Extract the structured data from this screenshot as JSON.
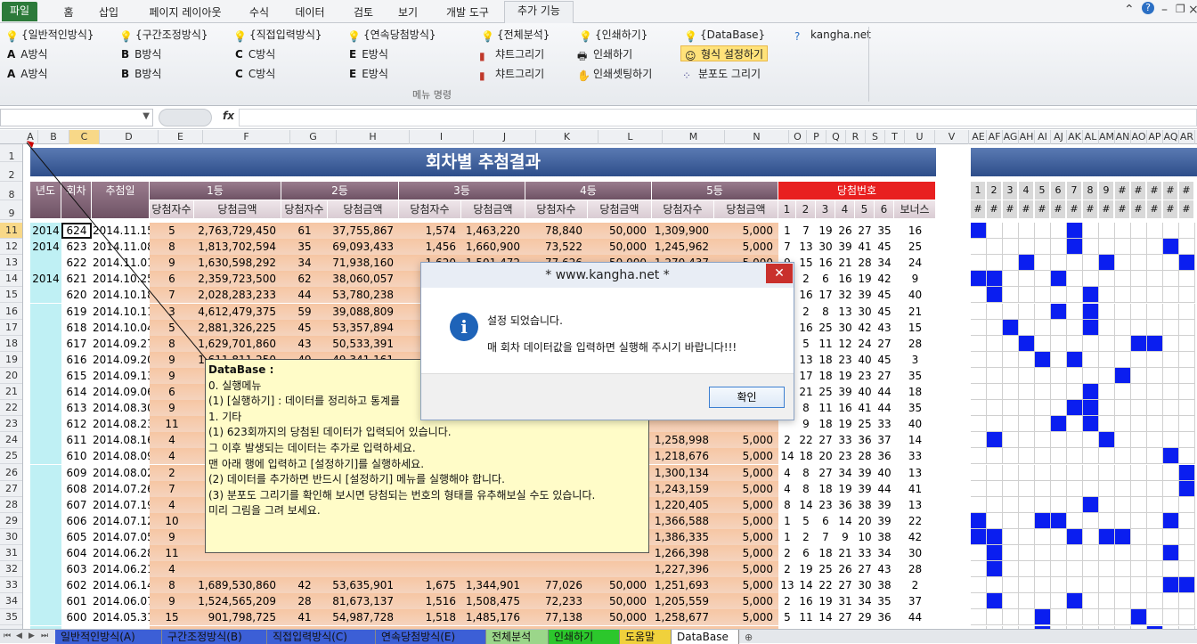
{
  "ribbon_tabs": [
    "파일",
    "홈",
    "삽입",
    "페이지 레이아웃",
    "수식",
    "데이터",
    "검토",
    "보기",
    "개발 도구",
    "추가 기능"
  ],
  "ribbon": {
    "group_label": "메뉴 명령",
    "col1": [
      "{일반적인방식}",
      "A방식",
      "A방식"
    ],
    "col2": [
      "{구간조정방식}",
      "B방식",
      "B방식"
    ],
    "col3": [
      "{직접입력방식}",
      "C방식",
      "C방식"
    ],
    "col4": [
      "{연속당첨방식}",
      "E방식",
      "E방식"
    ],
    "col5": [
      "{전체분석}",
      "챠트그리기",
      "챠트그리기"
    ],
    "col6": [
      "{인쇄하기}",
      "인쇄하기",
      "인쇄셋팅하기"
    ],
    "col7": [
      "{DataBase}",
      "형식 설정하기",
      "분포도 그리기"
    ],
    "col8": [
      "kangha.net"
    ],
    "letters": [
      "A",
      "A",
      "B",
      "B",
      "C",
      "C",
      "E",
      "E"
    ]
  },
  "formula_bar": {
    "fx": "fx"
  },
  "column_headers": [
    "A",
    "B",
    "C",
    "D",
    "E",
    "F",
    "G",
    "H",
    "I",
    "J",
    "K",
    "L",
    "M",
    "N",
    "O",
    "P",
    "Q",
    "R",
    "S",
    "T",
    "U",
    "V",
    "AE",
    "AF",
    "AG",
    "AH",
    "AI",
    "AJ",
    "AK",
    "AL",
    "AM",
    "AN",
    "AO",
    "AP",
    "AQ",
    "AR"
  ],
  "row_headers": [
    "1",
    "2",
    "8",
    "9",
    "11",
    "12",
    "13",
    "14",
    "15",
    "16",
    "17",
    "18",
    "19",
    "20",
    "21",
    "22",
    "23",
    "24",
    "25",
    "26",
    "27",
    "28",
    "29",
    "30",
    "31",
    "32",
    "33",
    "34",
    "35",
    "36",
    "37"
  ],
  "sheet": {
    "title": "회차별 추첨결과",
    "headers": [
      "년도",
      "회차",
      "추첨일",
      "1등",
      "2등",
      "3등",
      "4등",
      "5등",
      "당첨번호"
    ],
    "subheaders": [
      "당첨자수",
      "당첨금액",
      "당첨자수",
      "당첨금액",
      "당첨자수",
      "당첨금액",
      "당첨자수",
      "당첨금액",
      "당첨자수",
      "당첨금액",
      "1",
      "2",
      "3",
      "4",
      "5",
      "6",
      "보너스"
    ],
    "grid_numbers": [
      "1",
      "2",
      "3",
      "4",
      "5",
      "6",
      "7",
      "8",
      "9",
      "#",
      "#",
      "#",
      "#",
      "#"
    ],
    "grid_hash": [
      "#",
      "#",
      "#",
      "#",
      "#",
      "#",
      "#",
      "#",
      "#",
      "#",
      "#",
      "#",
      "#",
      "#"
    ],
    "rows": [
      [
        "2014",
        "624",
        "2014.11.15",
        "5",
        "2,763,729,450",
        "61",
        "37,755,867",
        "1,574",
        "1,463,220",
        "78,840",
        "50,000",
        "1,309,900",
        "5,000",
        "1",
        "7",
        "19",
        "26",
        "27",
        "35",
        "16"
      ],
      [
        "2014",
        "623",
        "2014.11.08",
        "8",
        "1,813,702,594",
        "35",
        "69,093,433",
        "1,456",
        "1,660,900",
        "73,522",
        "50,000",
        "1,245,962",
        "5,000",
        "7",
        "13",
        "30",
        "39",
        "41",
        "45",
        "25"
      ],
      [
        "",
        "622",
        "2014.11.01",
        "9",
        "1,630,598,292",
        "34",
        "71,938,160",
        "1,620",
        "1,501,472",
        "77,626",
        "50,000",
        "1,270,437",
        "5,000",
        "9",
        "15",
        "16",
        "21",
        "28",
        "34",
        "24"
      ],
      [
        "2014",
        "621",
        "2014.10.25",
        "6",
        "2,359,723,500",
        "62",
        "38,060,057",
        "",
        "",
        "",
        "",
        "",
        "",
        "1",
        "2",
        "6",
        "16",
        "19",
        "42",
        "9"
      ],
      [
        "",
        "620",
        "2014.10.18",
        "7",
        "2,028,283,233",
        "44",
        "53,780,238",
        "",
        "",
        "",
        "",
        "",
        "",
        "",
        "16",
        "17",
        "32",
        "39",
        "45",
        "40"
      ],
      [
        "",
        "619",
        "2014.10.11",
        "3",
        "4,612,479,375",
        "59",
        "39,088,809",
        "",
        "",
        "",
        "",
        "",
        "",
        "",
        "2",
        "8",
        "13",
        "30",
        "45",
        "21"
      ],
      [
        "",
        "618",
        "2014.10.04",
        "5",
        "2,881,326,225",
        "45",
        "53,357,894",
        "",
        "",
        "",
        "",
        "",
        "",
        "",
        "16",
        "25",
        "30",
        "42",
        "43",
        "15"
      ],
      [
        "",
        "617",
        "2014.09.27",
        "8",
        "1,629,701,860",
        "43",
        "50,533,391",
        "",
        "",
        "",
        "",
        "",
        "",
        "",
        "5",
        "11",
        "12",
        "24",
        "27",
        "28"
      ],
      [
        "",
        "616",
        "2014.09.20",
        "9",
        "1,611,811,250",
        "49",
        "49,341,161",
        "",
        "",
        "",
        "",
        "",
        "",
        "",
        "13",
        "18",
        "23",
        "40",
        "45",
        "3"
      ],
      [
        "",
        "615",
        "2014.09.13",
        "9",
        "",
        "",
        "",
        "",
        "",
        "",
        "",
        "",
        "",
        "",
        "17",
        "18",
        "19",
        "23",
        "27",
        "35"
      ],
      [
        "",
        "614",
        "2014.09.06",
        "6",
        "",
        "",
        "",
        "",
        "",
        "",
        "",
        "",
        "",
        "",
        "21",
        "25",
        "39",
        "40",
        "44",
        "18"
      ],
      [
        "",
        "613",
        "2014.08.30",
        "9",
        "",
        "",
        "",
        "",
        "",
        "",
        "",
        "",
        "",
        "",
        "8",
        "11",
        "16",
        "41",
        "44",
        "35"
      ],
      [
        "",
        "612",
        "2014.08.23",
        "11",
        "",
        "",
        "",
        "",
        "",
        "",
        "",
        "",
        "",
        "",
        "9",
        "18",
        "19",
        "25",
        "33",
        "40"
      ],
      [
        "",
        "611",
        "2014.08.16",
        "4",
        "",
        "",
        "",
        "",
        "",
        "",
        "",
        "1,258,998",
        "5,000",
        "2",
        "22",
        "27",
        "33",
        "36",
        "37",
        "14"
      ],
      [
        "",
        "610",
        "2014.08.09",
        "4",
        "",
        "",
        "",
        "",
        "",
        "",
        "",
        "1,218,676",
        "5,000",
        "14",
        "18",
        "20",
        "23",
        "28",
        "36",
        "33"
      ],
      [
        "",
        "609",
        "2014.08.02",
        "2",
        "",
        "",
        "",
        "",
        "",
        "",
        "",
        "1,300,134",
        "5,000",
        "4",
        "8",
        "27",
        "34",
        "39",
        "40",
        "13"
      ],
      [
        "",
        "608",
        "2014.07.26",
        "7",
        "",
        "",
        "",
        "",
        "",
        "",
        "",
        "1,243,159",
        "5,000",
        "4",
        "8",
        "18",
        "19",
        "39",
        "44",
        "41"
      ],
      [
        "",
        "607",
        "2014.07.19",
        "4",
        "",
        "",
        "",
        "",
        "",
        "",
        "",
        "1,220,405",
        "5,000",
        "8",
        "14",
        "23",
        "36",
        "38",
        "39",
        "13"
      ],
      [
        "",
        "606",
        "2014.07.12",
        "10",
        "",
        "",
        "",
        "",
        "",
        "",
        "",
        "1,366,588",
        "5,000",
        "1",
        "5",
        "6",
        "14",
        "20",
        "39",
        "22"
      ],
      [
        "",
        "605",
        "2014.07.05",
        "9",
        "",
        "",
        "",
        "",
        "",
        "",
        "",
        "1,386,335",
        "5,000",
        "1",
        "2",
        "7",
        "9",
        "10",
        "38",
        "42"
      ],
      [
        "",
        "604",
        "2014.06.28",
        "11",
        "",
        "",
        "",
        "",
        "",
        "",
        "",
        "1,266,398",
        "5,000",
        "2",
        "6",
        "18",
        "21",
        "33",
        "34",
        "30"
      ],
      [
        "",
        "603",
        "2014.06.21",
        "4",
        "",
        "",
        "",
        "",
        "",
        "",
        "",
        "1,227,396",
        "5,000",
        "2",
        "19",
        "25",
        "26",
        "27",
        "43",
        "28"
      ],
      [
        "",
        "602",
        "2014.06.14",
        "8",
        "1,689,530,860",
        "42",
        "53,635,901",
        "1,675",
        "1,344,901",
        "77,026",
        "50,000",
        "1,251,693",
        "5,000",
        "13",
        "14",
        "22",
        "27",
        "30",
        "38",
        "2"
      ],
      [
        "",
        "601",
        "2014.06.07",
        "9",
        "1,524,565,209",
        "28",
        "81,673,137",
        "1,516",
        "1,508,475",
        "72,233",
        "50,000",
        "1,205,559",
        "5,000",
        "2",
        "16",
        "19",
        "31",
        "34",
        "35",
        "37"
      ],
      [
        "",
        "600",
        "2014.05.31",
        "15",
        "901,798,725",
        "41",
        "54,987,728",
        "1,518",
        "1,485,176",
        "77,138",
        "50,000",
        "1,258,677",
        "5,000",
        "5",
        "11",
        "14",
        "27",
        "29",
        "36",
        "44"
      ],
      [
        "",
        "599",
        "2014.05.24",
        "8",
        "1,710,918,329",
        "43",
        "53,051,732",
        "1,685",
        "1,353,843",
        "79,069",
        "50,000",
        "1,297,530",
        "5,000",
        "5",
        "12",
        "17",
        "29",
        "34",
        "35",
        "27"
      ],
      [
        "",
        "598",
        "2014.05.17",
        "16",
        "833,998,594",
        "50",
        "44,479,925",
        "2,053",
        "1,083,291",
        "86,005",
        "50,000",
        "1,333,411",
        "5,000",
        "4",
        "12",
        "24",
        "33",
        "38",
        "45",
        "22"
      ]
    ]
  },
  "dialog": {
    "title": "* www.kangha.net *",
    "close": "✕",
    "line1": "설정 되었습니다.",
    "line2": "매 회차 데이터값을 입력하면 실행해 주시기 바랍니다!!!",
    "ok": "확인"
  },
  "note": {
    "lines": [
      "DataBase :",
      "0. 실행메뉴",
      "    (1) [실행하기] : 데이터를 정리하고 통계를",
      "",
      "1. 기타",
      "    (1) 623회까지의 당첨된 데이터가 입력되어 있습니다.",
      "         그 이후 발생되는 데이터는 추가로 입력하세요.",
      "         맨 아래 행에 입력하고 [설정하기]를 실행하세요.",
      "    (2) 데이터를 추가하면 반드시 [설정하기] 메뉴를 실행해야 합니다.",
      "    (3) 분포도 그리기를 확인해 보시면 당첨되는 번호의 형태를 유추해보실 수도 있습니다.",
      "         미리 그림을 그려 보세요."
    ]
  },
  "sheet_tabs": [
    "일반적인방식(A)",
    "구간조정방식(B)",
    "직접입력방식(C)",
    "연속당첨방식(E)",
    "전체분석",
    "인쇄하기",
    "도움말",
    "DataBase"
  ],
  "colors": {
    "tab_green": "#2c7a3a",
    "title_blue": "#2e4e8a",
    "grid_blue": "#0a1ef0",
    "win_red": "#e82020"
  }
}
